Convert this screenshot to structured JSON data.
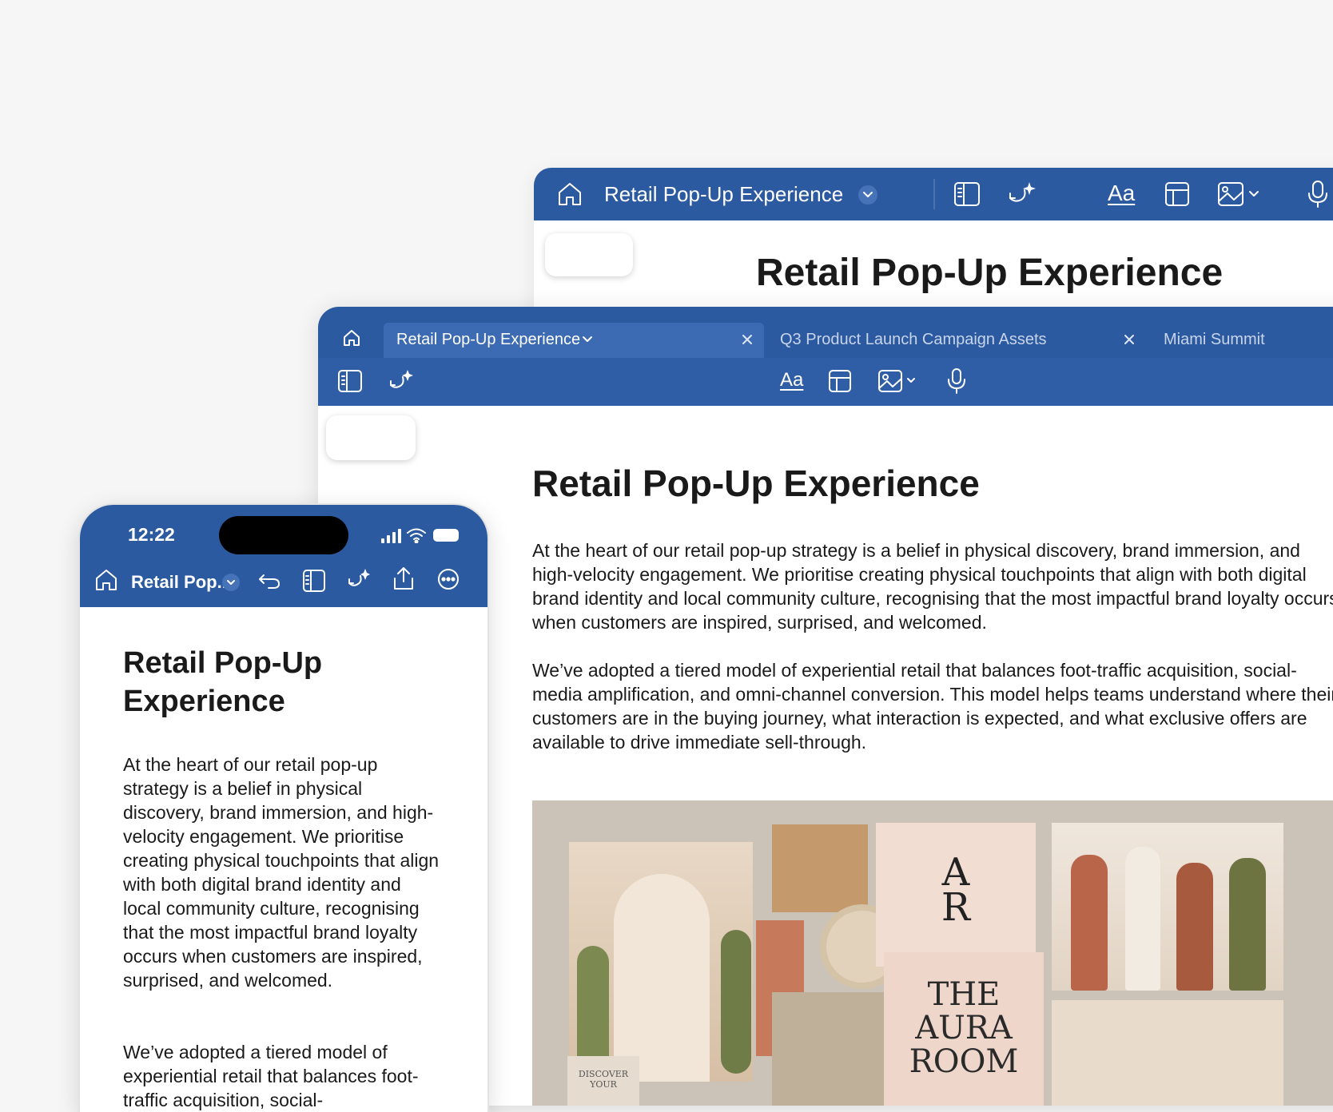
{
  "back_window": {
    "doc_title": "Retail Pop-Up Experience",
    "heading": "Retail Pop-Up Experience",
    "text_button": "Aa"
  },
  "mid_window": {
    "tabs": [
      {
        "label": "Retail Pop-Up Experience",
        "active": true
      },
      {
        "label": "Q3 Product Launch Campaign Assets",
        "active": false
      },
      {
        "label": "Miami Summit",
        "active": false
      }
    ],
    "text_button": "Aa",
    "heading": "Retail Pop-Up Experience",
    "paragraphs": [
      "At the heart of our retail pop-up strategy is a belief in physical discovery, brand immersion, and high-velocity engagement. We prioritise creating physical touchpoints that align with both digital brand identity and local community culture, recognising that the most impactful brand loyalty occurs when customers are inspired, surprised, and welcomed.",
      "We’ve adopted a tiered model of experiential retail that balances foot-traffic acquisition, social-media amplification, and omni-channel conversion. This model helps teams understand where their customers are in the buying journey, what interaction is expected, and what exclusive offers are available to drive immediate sell-through."
    ],
    "moodboard": {
      "logo_top": "A",
      "logo_bottom": "R",
      "brand_lines": [
        "THE",
        "AURA",
        "ROOM"
      ],
      "card_text_1": "DISCOVER",
      "card_text_2": "YOUR"
    }
  },
  "phone": {
    "time": "12:22",
    "doc_title": "Retail Pop...",
    "heading": "Retail Pop-Up Experience",
    "paragraphs": [
      "At the heart of our retail pop-up strategy is a belief in physical discovery, brand immersion, and high-velocity engagement. We prioritise creating physical touchpoints that align with both digital brand identity and local community culture, recognising that the most impactful brand loyalty occurs when customers are inspired, surprised, and welcomed.",
      "We’ve adopted a tiered model of experiential retail that balances foot-traffic acquisition, social-"
    ]
  },
  "colors": {
    "toolbar_blue": "#2c5aa0",
    "tab_active": "#3d6bb3",
    "page_bg": "#f6f6f6"
  }
}
